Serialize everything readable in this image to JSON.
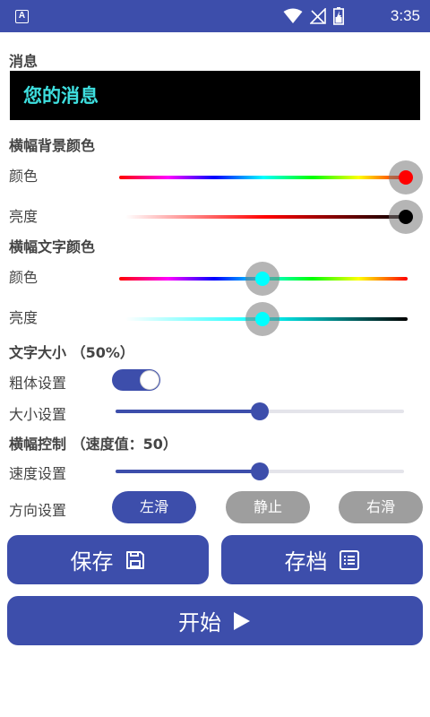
{
  "status_bar": {
    "app_badge": "A",
    "time": "3:35"
  },
  "message": {
    "heading": "消息",
    "text": "您的消息",
    "text_color": "#3ee0e0",
    "background": "#000000"
  },
  "banner_bg_color": {
    "heading": "横幅背景颜色",
    "color_label": "颜色",
    "brightness_label": "亮度",
    "color_value": "#ff0000",
    "brightness_value": "#000000"
  },
  "banner_text_color": {
    "heading": "横幅文字颜色",
    "color_label": "颜色",
    "brightness_label": "亮度",
    "color_value": "#00ffff",
    "brightness_value": "#00ffff"
  },
  "text_size": {
    "heading": "文字大小 （50%）",
    "bold_label": "粗体设置",
    "bold_enabled": true,
    "size_label": "大小设置",
    "size_fraction": 0.5
  },
  "banner_control": {
    "heading": "横幅控制 （速度值：50）",
    "speed_label": "速度设置",
    "speed_fraction": 0.5,
    "direction_label": "方向设置",
    "directions": [
      "左滑",
      "静止",
      "右滑"
    ],
    "selected_direction": "左滑"
  },
  "actions": {
    "save_label": "保存",
    "archive_label": "存档",
    "start_label": "开始"
  },
  "colors": {
    "accent": "#3d4eab",
    "inactive_pill": "#9e9e9e"
  },
  "icons": {
    "save": "floppy-disk-icon",
    "archive": "list-document-icon",
    "start": "play-icon"
  }
}
